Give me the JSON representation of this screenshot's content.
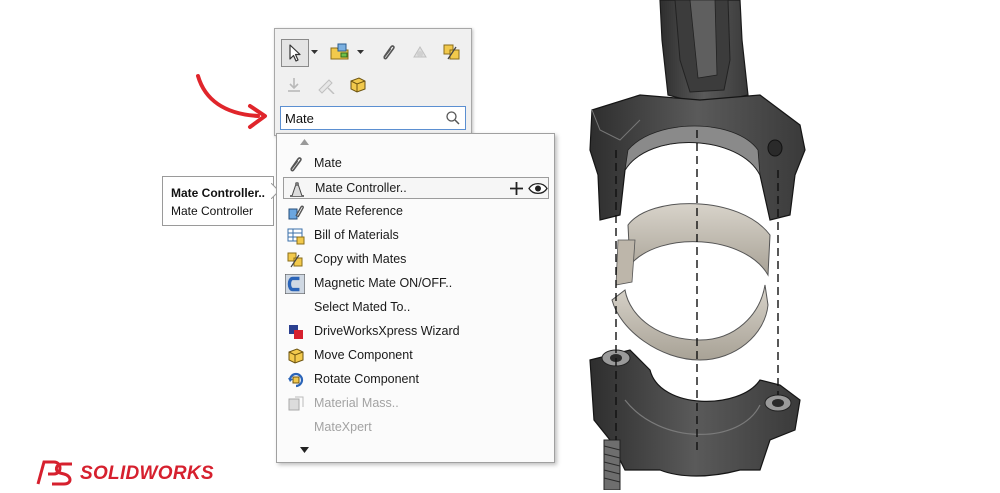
{
  "toolbar": {
    "row1": [
      {
        "icon": "select-arrow-icon",
        "selected": true
      },
      {
        "icon": "open-folder-icon"
      },
      {
        "icon": "mate-paperclip-icon"
      },
      {
        "icon": "smart-mate-icon"
      },
      {
        "icon": "copy-with-mates-icon"
      }
    ],
    "row2": [
      {
        "icon": "insert-component-icon",
        "disabled": true
      },
      {
        "icon": "edit-mate-icon",
        "disabled": true
      },
      {
        "icon": "move-component-icon"
      }
    ]
  },
  "search": {
    "value": "Mate",
    "placeholder": ""
  },
  "tooltip": {
    "title": "Mate Controller..",
    "description": "Mate Controller"
  },
  "menu": {
    "items": [
      {
        "label": "Mate",
        "icon": "paperclip-icon"
      },
      {
        "label": "Mate Controller..",
        "icon": "mate-controller-icon",
        "highlighted": true
      },
      {
        "label": "Mate Reference",
        "icon": "mate-reference-icon"
      },
      {
        "label": "Bill of Materials",
        "icon": "bill-of-materials-icon"
      },
      {
        "label": "Copy with Mates",
        "icon": "copy-with-mates-icon"
      },
      {
        "label": "Magnetic Mate ON/OFF..",
        "icon": "magnet-icon"
      },
      {
        "label": "Select Mated To..",
        "icon": ""
      },
      {
        "label": "DriveWorksXpress Wizard",
        "icon": "driveworks-icon"
      },
      {
        "label": "Move Component",
        "icon": "move-component-icon"
      },
      {
        "label": "Rotate Component",
        "icon": "rotate-component-icon"
      },
      {
        "label": "Material Mass..",
        "icon": "material-mass-icon",
        "disabled": true
      },
      {
        "label": "MateXpert",
        "icon": "",
        "disabled": true
      }
    ]
  },
  "brand": {
    "name": "SOLIDWORKS",
    "color": "#d6202e"
  },
  "colors": {
    "annotation_arrow": "#e0252b",
    "part_body": "#4a4a4a",
    "bearing_shell": "#c8c2b8"
  }
}
